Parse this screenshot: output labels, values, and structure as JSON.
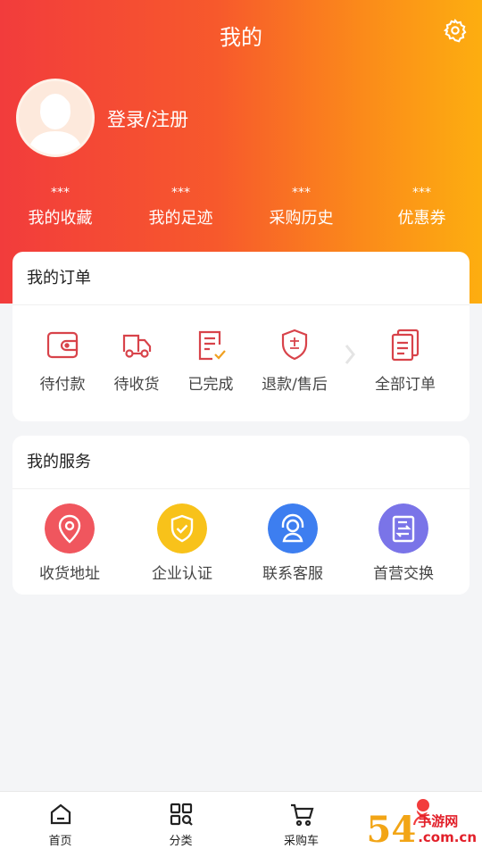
{
  "header": {
    "title": "我的",
    "login_text": "登录/注册",
    "gradient_colors": [
      "#f23c3c",
      "#fdae10"
    ]
  },
  "stats": [
    {
      "value": "***",
      "label": "我的收藏"
    },
    {
      "value": "***",
      "label": "我的足迹"
    },
    {
      "value": "***",
      "label": "采购历史"
    },
    {
      "value": "***",
      "label": "优惠券"
    }
  ],
  "orders": {
    "title": "我的订单",
    "items": [
      {
        "label": "待付款",
        "icon": "wallet-icon"
      },
      {
        "label": "待收货",
        "icon": "truck-icon"
      },
      {
        "label": "已完成",
        "icon": "completed-doc-icon"
      },
      {
        "label": "退款/售后",
        "icon": "after-sale-shield-icon"
      }
    ],
    "all_label": "全部订单",
    "all_icon": "orders-list-icon",
    "icon_color": "#d8434a"
  },
  "services": {
    "title": "我的服务",
    "items": [
      {
        "label": "收货地址",
        "icon": "location-pin-icon",
        "color": "#f0565e"
      },
      {
        "label": "企业认证",
        "icon": "shield-check-icon",
        "color": "#f8c21a"
      },
      {
        "label": "联系客服",
        "icon": "customer-service-icon",
        "color": "#3d7ef0"
      },
      {
        "label": "首营交换",
        "icon": "exchange-doc-icon",
        "color": "#7a74e8"
      }
    ]
  },
  "tabbar": [
    {
      "label": "首页",
      "icon": "home-icon"
    },
    {
      "label": "分类",
      "icon": "category-grid-icon"
    },
    {
      "label": "采购车",
      "icon": "cart-icon"
    },
    {
      "label": "",
      "icon": "profile-icon"
    }
  ],
  "watermark": {
    "logo": "54 手游网",
    "big": "54",
    "line1": "手游网",
    "line2": ".com.cn"
  }
}
